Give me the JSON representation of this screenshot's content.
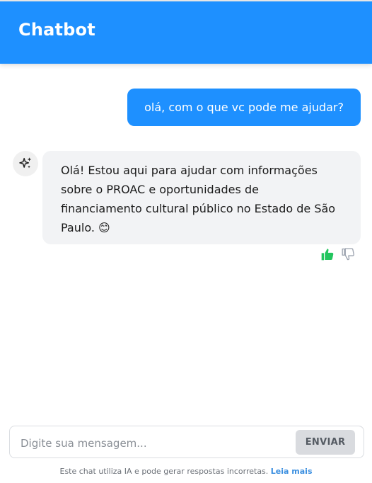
{
  "header": {
    "title": "Chatbot"
  },
  "messages": {
    "user": {
      "text": "olá, com o que vc pode me ajudar?"
    },
    "bot": {
      "avatar_icon": "sparkles-icon",
      "text": "Olá! Estou aqui para ajudar com informações sobre o PROAC e oportunidades de financiamento cultural público no Estado de São Paulo. 😊"
    }
  },
  "feedback": {
    "like_icon": "thumbs-up-icon",
    "like_color": "#22c55e",
    "dislike_icon": "thumbs-down-icon",
    "dislike_color": "#9ca3af"
  },
  "composer": {
    "placeholder": "Digite sua mensagem...",
    "value": "",
    "send_label": "ENVIAR"
  },
  "footer": {
    "disclaimer": "Este chat utiliza IA e pode gerar respostas incorretas.",
    "link_label": "Leia mais"
  },
  "colors": {
    "accent": "#1e90ff",
    "bot_bubble": "#f2f3f5",
    "link": "#3b8fe0"
  }
}
